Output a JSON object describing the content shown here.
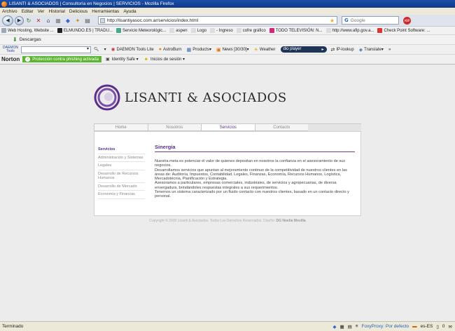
{
  "window": {
    "title": "LISANTI & ASOCIADOS | Consultoría en Negocios | SERVICIOS - Mozilla Firefox"
  },
  "menu": [
    "Archivo",
    "Editar",
    "Ver",
    "Historial",
    "Delicious",
    "Herramientas",
    "Ayuda"
  ],
  "nav": {
    "url": "http://lisantiyasoc.com.ar/servicios/index.html",
    "search_placeholder": "Google",
    "search_engine_icon": "google-g-icon"
  },
  "bookmarks": [
    "Web Hosting, Website ...",
    "ELMUNDO.ES | TRADU...",
    "Servicio Meteorológic...",
    "aspen",
    "Logo",
    "- Ingreso",
    "cofre gráfico",
    "TODO TELEVISIÓN: N...",
    "http://www.afip.gov.a...",
    "Check Point Software: ..."
  ],
  "downloads_label": "Descargas",
  "daemon": {
    "logo_line1": "DAEMON",
    "logo_line2": "Tools",
    "items": [
      "DAEMON Tools Lite",
      "AstroBurn",
      "Products",
      "News [30/30]",
      "Weather",
      "IP-lookup",
      "Translate"
    ],
    "player_label": "dio player"
  },
  "norton": {
    "logo": "Norton",
    "phishing": "Protección contra phishing activada",
    "identity": "Identity Safe",
    "sessions": "Inicios de sesión"
  },
  "site": {
    "logo_text": "LISANTI & ASOCIADOS",
    "tabs": [
      "Home",
      "Nosotros",
      "Servicios",
      "Contacto"
    ],
    "active_tab": "Servicios",
    "sidebar": [
      "Servicios",
      "Administración y Sistemas",
      "Legales",
      "Desarrollo de Recursos Humanos",
      "Desarrollo de Mercado",
      "Economía y Finanzas"
    ],
    "heading": "Sinergia",
    "paragraphs": [
      "Nuestra meta es potenciar el valor de quienes depositan en nosotros la confianza en el asesoramiento de sus negocios.",
      "Desarrollamos servicios que apuntan al mejoramiento continuo de la competitividad de nuestros clientes en las áreas de: Auditoría, Impuestos, Contabilidad, Legales, Finanzas, Economía, Recursos Humanos, Logística, Mercadotécnia, Planificación y Estrategia.",
      "Asesoramos a particulares, empresas comerciales, industriales, de servicios y agropecuarias, de diversa envergadura, brindándoles respuestas integrales a sus requerimientos.",
      "Tenemos un sistema caracterizado por un fluido contacto con nuestros clientes, basado en un contacto directo y personal."
    ],
    "copyright": "Copyright © 2009 Lisanti & Asociados. Todos Los Derechos Reservados. Diseño:",
    "designer": "DG Noelia Movilla"
  },
  "status": {
    "text": "Terminado",
    "foxyproxy": "FoxyProxy: Por defecto",
    "locale": "es-ES",
    "count": "0"
  }
}
